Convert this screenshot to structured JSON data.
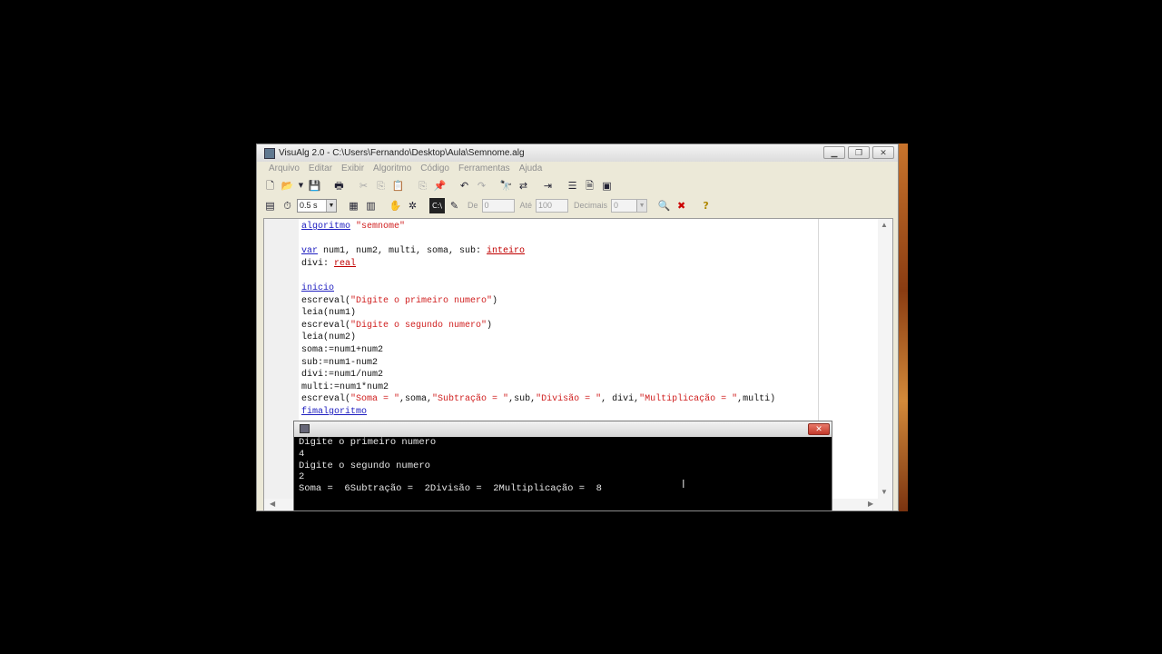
{
  "window": {
    "title": "VisuAlg 2.0 - C:\\Users\\Fernando\\Desktop\\Aula\\Semnome.alg",
    "controls": [
      "minimize-icon",
      "restore-icon",
      "close-icon"
    ]
  },
  "menu": {
    "items": [
      "Arquivo",
      "Editar",
      "Exibir",
      "Algoritmo",
      "Código",
      "Ferramentas",
      "Ajuda"
    ]
  },
  "toolbar2": {
    "speed": "0.5 s",
    "de_label": "De",
    "de_value": "0",
    "ate_label": "Até",
    "ate_value": "100",
    "decimais_label": "Decimais",
    "decimais_value": "0"
  },
  "code": {
    "line1_kw": "algoritmo",
    "line1_str": "\"semnome\"",
    "line3_kw": "var",
    "line3_text": " num1, num2, multi, soma, sub: ",
    "line3_type": "inteiro",
    "line4_text": "divi: ",
    "line4_type": "real",
    "line6_kw": "inicio",
    "line7_a": "escreval(",
    "line7_str": "\"Digite o primeiro numero\"",
    "line7_b": ")",
    "line8": "leia(num1)",
    "line9_a": "escreval(",
    "line9_str": "\"Digite o segundo numero\"",
    "line9_b": ")",
    "line10": "leia(num2)",
    "line11": "soma:=num1+num2",
    "line12": "sub:=num1-num2",
    "line13": "divi:=num1/num2",
    "line14": "multi:=num1*num2",
    "line15_a": "escreval(",
    "line15_s1": "\"Soma = \"",
    "line15_b": ",soma,",
    "line15_s2": "\"Subtração = \"",
    "line15_c": ",sub,",
    "line15_s3": "\"Divisão = \"",
    "line15_d": ", divi,",
    "line15_s4": "\"Multiplicação = \"",
    "line15_e": ",multi)",
    "line16_kw": "fimalgoritmo"
  },
  "console": {
    "lines": [
      "Digite o primeiro numero",
      "4",
      "Digite o segundo numero",
      "2",
      "Soma =  6Subtração =  2Divisão =  2Multiplicação =  8"
    ]
  }
}
